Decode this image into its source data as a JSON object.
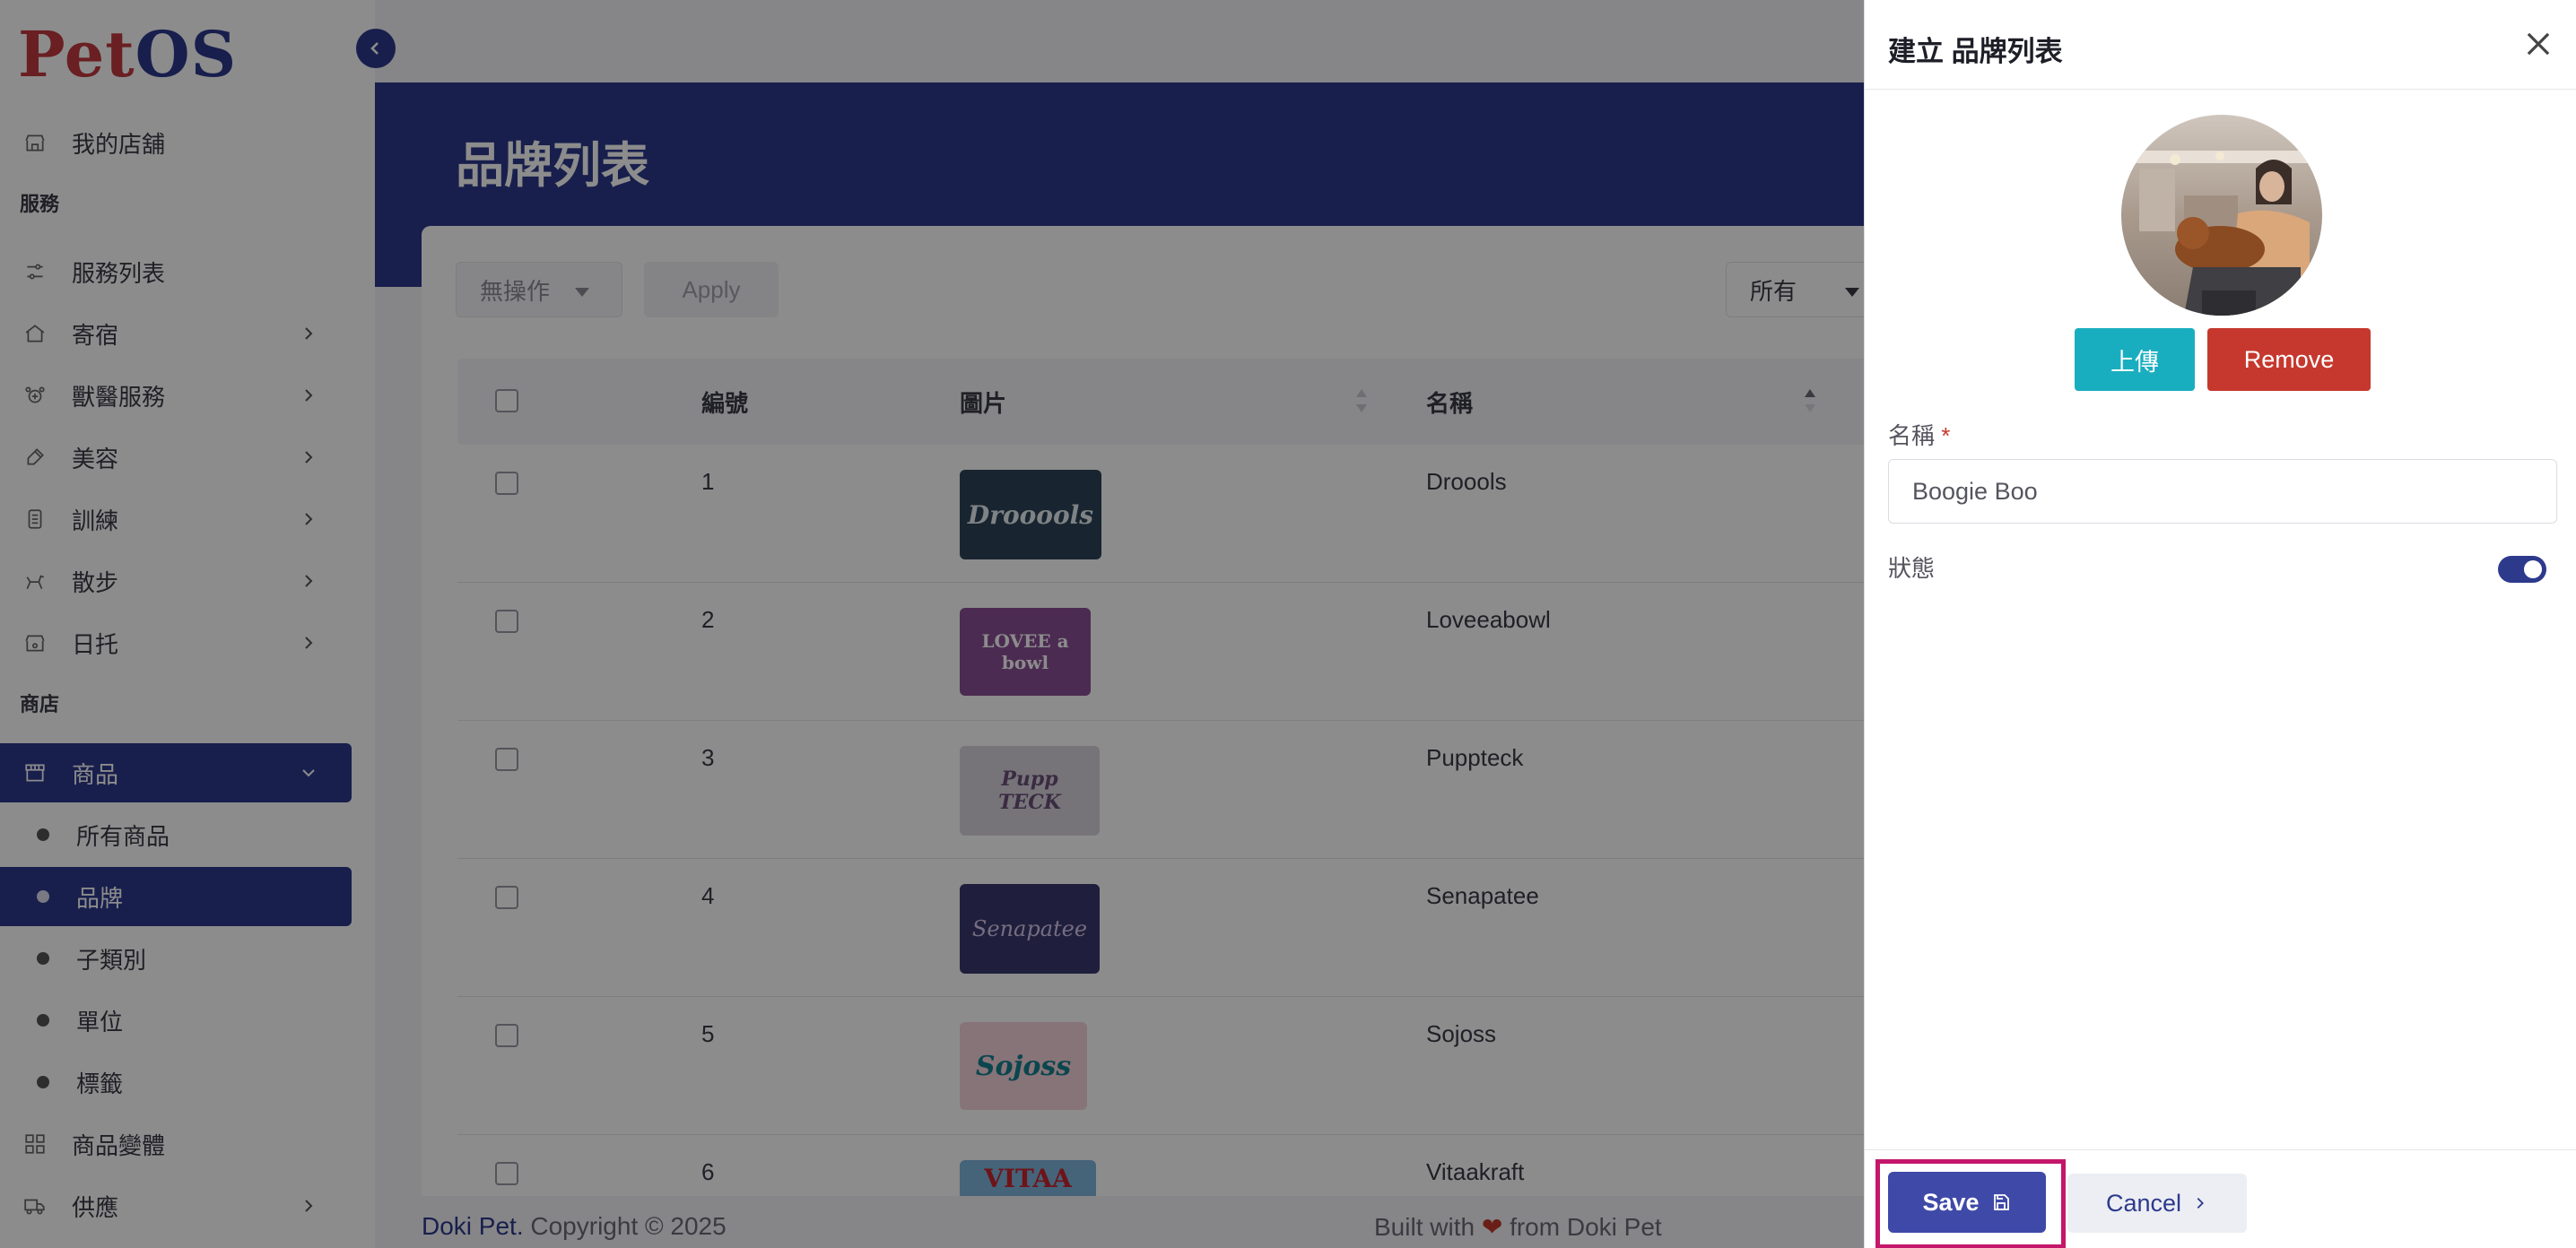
{
  "app": {
    "logo_pet": "Pet",
    "logo_os": "OS"
  },
  "sidebar": {
    "my_store": "我的店舖",
    "section_service": "服務",
    "items_service": [
      {
        "label": "服務列表"
      },
      {
        "label": "寄宿"
      },
      {
        "label": "獸醫服務"
      },
      {
        "label": "美容"
      },
      {
        "label": "訓練"
      },
      {
        "label": "散步"
      },
      {
        "label": "日托"
      }
    ],
    "section_store": "商店",
    "products": "商品",
    "sub_items": [
      {
        "label": "所有商品"
      },
      {
        "label": "品牌"
      },
      {
        "label": "子類別"
      },
      {
        "label": "單位"
      },
      {
        "label": "標籤"
      }
    ],
    "variants": "商品變體",
    "supply": "供應"
  },
  "page": {
    "title": "品牌列表",
    "bulk_action": "無操作",
    "apply": "Apply",
    "filter": "所有",
    "columns": {
      "id": "編號",
      "image": "圖片",
      "name": "名稱"
    },
    "rows": [
      {
        "id": "1",
        "name": "Droools",
        "logo_text": "Drooools",
        "bg": "#2c4458",
        "fg": "#e8eef2"
      },
      {
        "id": "2",
        "name": "Loveeabowl",
        "logo_text": "LOVEE a bowl",
        "bg": "#8a4f96",
        "fg": "#ffffff"
      },
      {
        "id": "3",
        "name": "Puppteck",
        "logo_text": "Pupp TECK",
        "bg": "#d8d4dc",
        "fg": "#6b4f78"
      },
      {
        "id": "4",
        "name": "Senapatee",
        "logo_text": "Senapatee",
        "bg": "#3a3a70",
        "fg": "#d6c7ea"
      },
      {
        "id": "5",
        "name": "Sojoss",
        "logo_text": "Sojoss",
        "bg": "#f6d4da",
        "fg": "#14808f"
      },
      {
        "id": "6",
        "name": "Vitaakraft",
        "logo_text": "VITAA",
        "bg": "#7fb4dd",
        "fg": "#c8232c"
      }
    ]
  },
  "footer": {
    "brand": "Doki Pet.",
    "copyright": "Copyright © 2025",
    "built": "Built with",
    "heart": "❤",
    "from": "from Doki Pet"
  },
  "drawer": {
    "title": "建立 品牌列表",
    "upload": "上傳",
    "remove": "Remove",
    "name_label": "名稱",
    "required_mark": "*",
    "name_value": "Boogie Boo",
    "status_label": "狀態",
    "status_on": true,
    "save": "Save",
    "cancel": "Cancel"
  }
}
